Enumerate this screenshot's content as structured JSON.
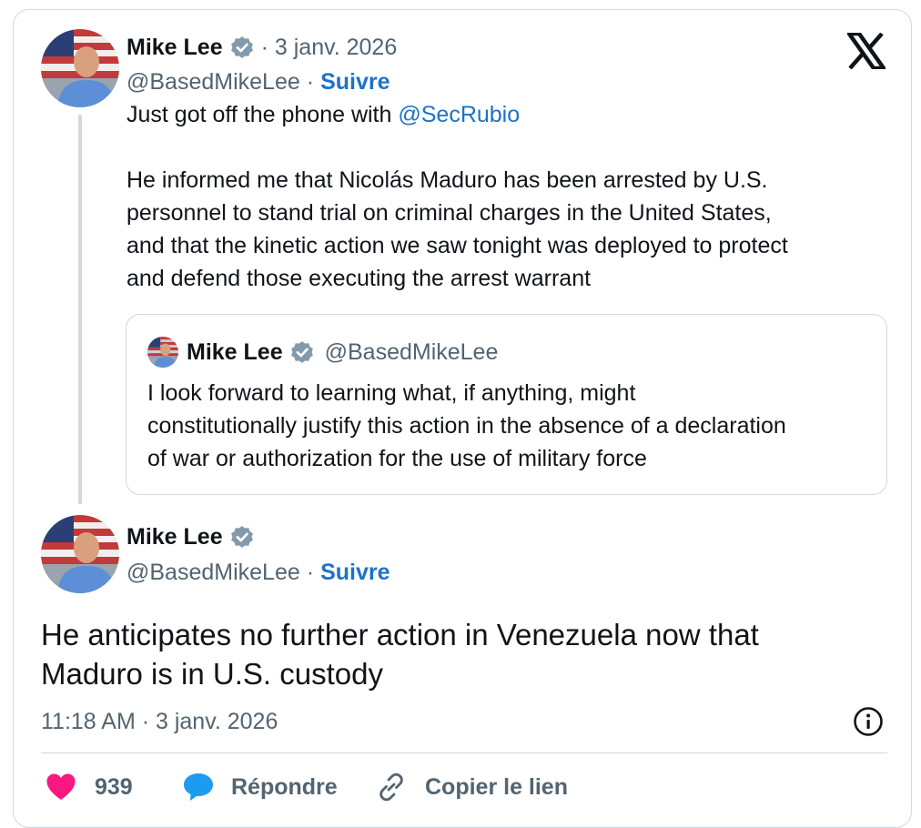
{
  "tweet1": {
    "author_name": "Mike Lee",
    "date": "· 3 janv. 2026",
    "handle": "@BasedMikeLee",
    "separator": "·",
    "follow_label": "Suivre",
    "text_intro": "Just got off the phone with ",
    "mention": "@SecRubio",
    "text_body": "He informed me that Nicolás Maduro has been arrested by U.S.\npersonnel to stand trial on criminal charges in the United States,\nand that the kinetic action we saw tonight was deployed to protect\nand defend those executing the arrest warrant"
  },
  "quote": {
    "author_name": "Mike Lee",
    "handle": "@BasedMikeLee",
    "text": "I look forward to learning what, if anything, might\nconstitutionally justify this action in the absence of a declaration\nof war or authorization for the use of military force"
  },
  "tweet2": {
    "author_name": "Mike Lee",
    "handle": "@BasedMikeLee",
    "separator": "·",
    "follow_label": "Suivre",
    "text": "He anticipates no further action in Venezuela now that\nMaduro is in U.S. custody",
    "timestamp": "11:18 AM · 3 janv. 2026"
  },
  "actions": {
    "likes_count": "939",
    "reply_label": "Répondre",
    "copy_link_label": "Copier le lien"
  },
  "colors": {
    "link_blue": "#1d72c9",
    "like_pink": "#f91880",
    "reply_blue": "#1d9bf0",
    "verified_gray": "#829aab"
  },
  "icons": [
    "x-logo-icon",
    "verified-badge-icon",
    "info-icon",
    "heart-icon",
    "reply-bubble-icon",
    "link-icon"
  ]
}
